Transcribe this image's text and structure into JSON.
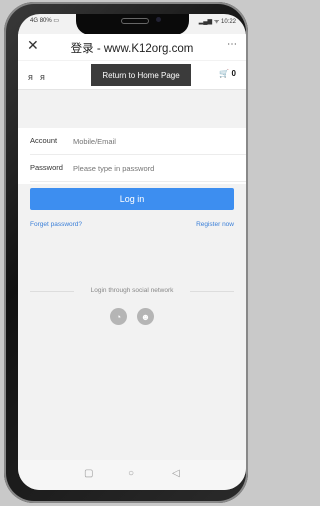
{
  "status": {
    "battery": "80%",
    "signal": "4G",
    "time": "10:22"
  },
  "topbar": {
    "close_icon": "close-icon",
    "title": "登录 - www.K12org.com",
    "more": "⋯"
  },
  "header": {
    "return_label": "Return to Home Page",
    "cart_count": "0"
  },
  "form": {
    "account_label": "Account",
    "account_placeholder": "Mobile/Email",
    "password_label": "Password",
    "password_placeholder": "Please type in password"
  },
  "login_button": "Log in",
  "links": {
    "forgot": "Forget password?",
    "register": "Register now"
  },
  "social": {
    "heading": "Login through social network",
    "icons": [
      "wechat-icon",
      "qq-icon"
    ]
  },
  "colors": {
    "primary": "#3d8ef0",
    "link": "#3a7fd8",
    "dark_button": "#3b3b3b"
  }
}
